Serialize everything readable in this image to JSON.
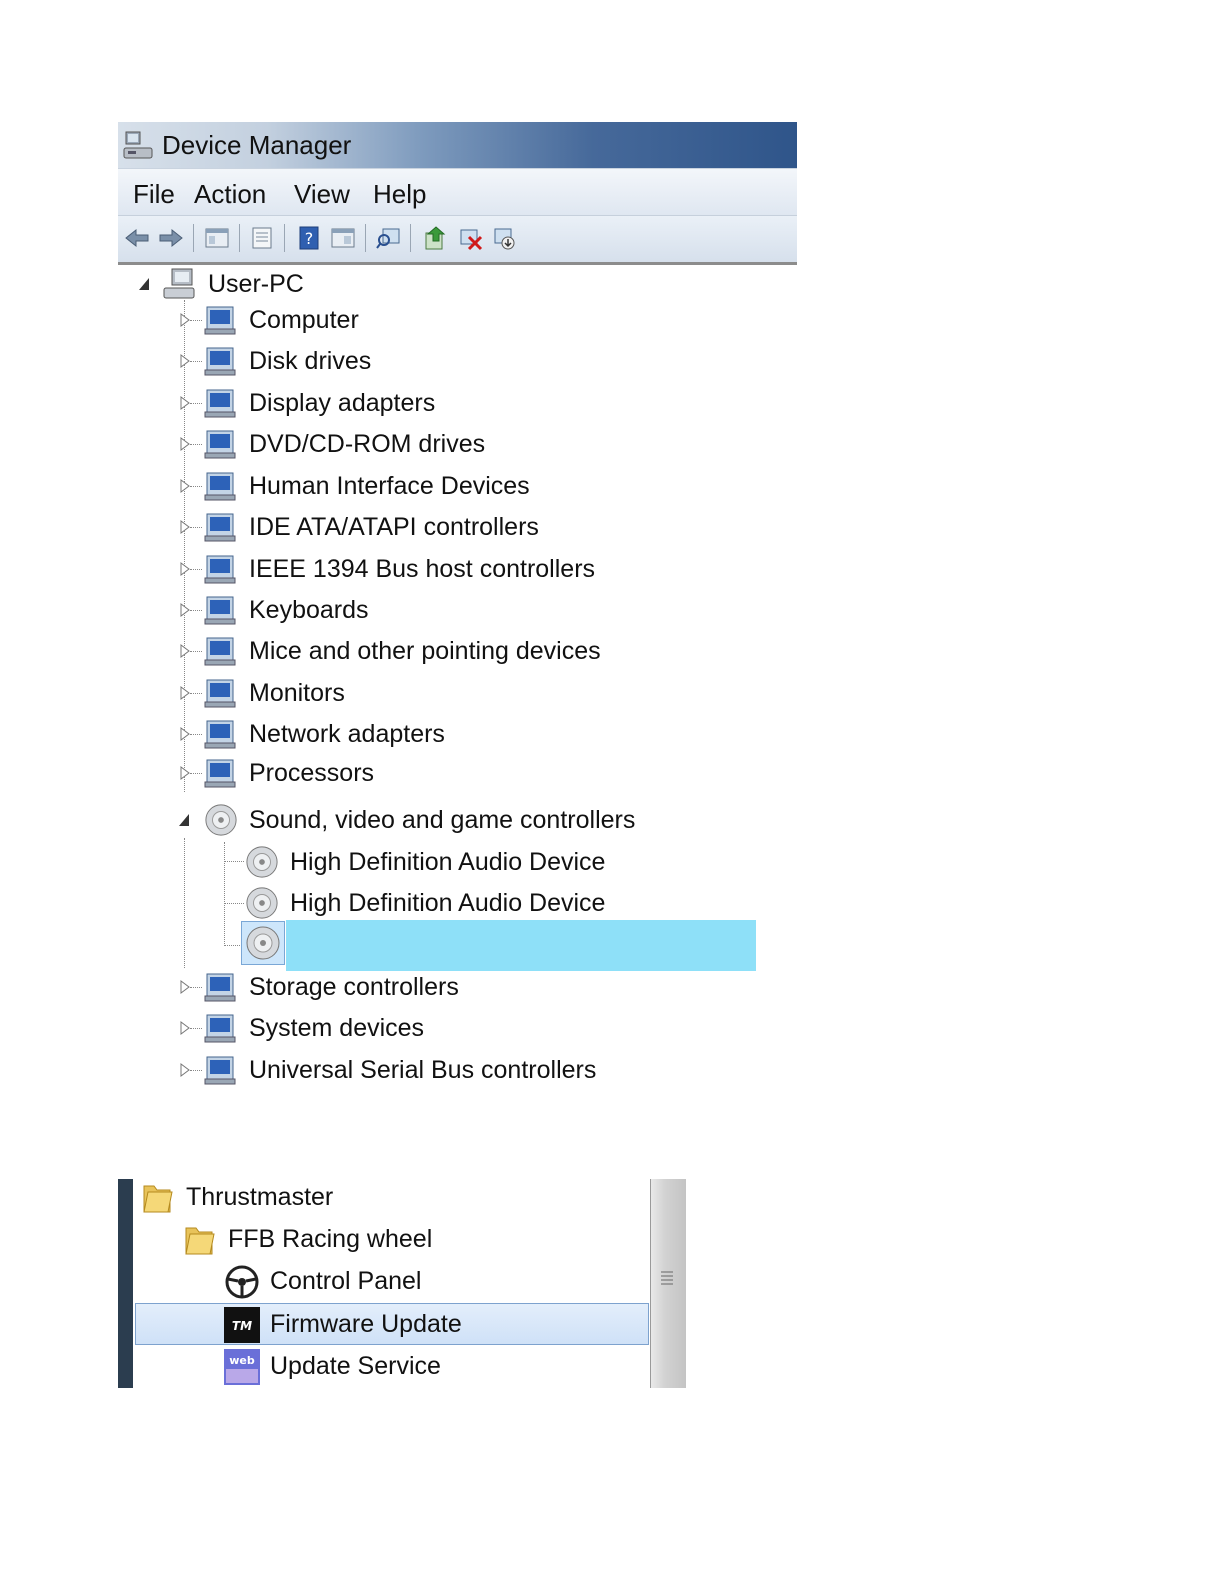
{
  "window": {
    "title": "Device Manager"
  },
  "menu": [
    "File",
    "Action",
    "View",
    "Help"
  ],
  "toolbar": [
    "back-icon",
    "forward-icon",
    "show-hide-tree-icon",
    "properties-icon",
    "help-icon",
    "view-icon",
    "scan-hardware-icon",
    "update-driver-icon",
    "uninstall-icon",
    "disable-icon"
  ],
  "tree": {
    "root": "User-PC",
    "categories": [
      "Computer",
      "Disk drives",
      "Display adapters",
      "DVD/CD-ROM drives",
      "Human Interface Devices",
      "IDE ATA/ATAPI controllers",
      "IEEE 1394 Bus host controllers",
      "Keyboards",
      "Mice and other pointing devices",
      "Monitors",
      "Network adapters",
      "Processors"
    ],
    "sound": {
      "label": "Sound, video and game controllers",
      "children": [
        "High Definition Audio Device",
        "High Definition Audio Device",
        ""
      ]
    },
    "after": [
      "Storage controllers",
      "System devices",
      "Universal Serial Bus controllers"
    ]
  },
  "start_menu": {
    "items": [
      "Thrustmaster",
      "FFB Racing wheel",
      "Control Panel",
      "Firmware Update",
      "Update Service"
    ],
    "highlighted": "Firmware Update"
  }
}
